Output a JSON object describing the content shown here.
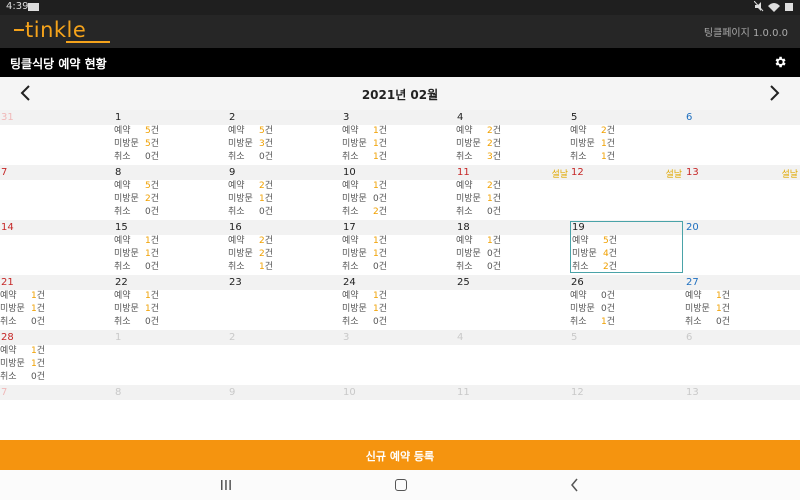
{
  "status": {
    "time": "4:39"
  },
  "app": {
    "logo_text": "tinkle",
    "version": "팅클페이지 1.0.0.0"
  },
  "title": "팅클식당  예약 현황",
  "month_label": "2021년 02월",
  "stat_labels": [
    "예약",
    "미방문",
    "취소"
  ],
  "unit": "건",
  "weeks": [
    [
      {
        "day": "31",
        "other": true,
        "sun": true
      },
      {
        "day": "1",
        "stats": [
          "5",
          "5",
          "0"
        ]
      },
      {
        "day": "2",
        "stats": [
          "5",
          "3",
          "0"
        ]
      },
      {
        "day": "3",
        "stats": [
          "1",
          "1",
          "1"
        ]
      },
      {
        "day": "4",
        "stats": [
          "2",
          "2",
          "3"
        ]
      },
      {
        "day": "5",
        "stats": [
          "2",
          "1",
          "1"
        ]
      },
      {
        "day": "6",
        "sat": true
      }
    ],
    [
      {
        "day": "7",
        "sun": true
      },
      {
        "day": "8",
        "stats": [
          "5",
          "2",
          "0"
        ]
      },
      {
        "day": "9",
        "stats": [
          "2",
          "1",
          "0"
        ]
      },
      {
        "day": "10",
        "stats": [
          "1",
          "0",
          "2"
        ]
      },
      {
        "day": "11",
        "holiday": "설날",
        "sun": true,
        "stats": [
          "2",
          "1",
          "0"
        ]
      },
      {
        "day": "12",
        "holiday": "설날",
        "sun": true
      },
      {
        "day": "13",
        "holiday": "설날",
        "sun": true
      }
    ],
    [
      {
        "day": "14",
        "sun": true
      },
      {
        "day": "15",
        "stats": [
          "1",
          "1",
          "0"
        ]
      },
      {
        "day": "16",
        "stats": [
          "2",
          "2",
          "1"
        ]
      },
      {
        "day": "17",
        "stats": [
          "1",
          "1",
          "0"
        ]
      },
      {
        "day": "18",
        "stats": [
          "1",
          "0",
          "0"
        ]
      },
      {
        "day": "19",
        "stats": [
          "5",
          "4",
          "2"
        ],
        "selected": true
      },
      {
        "day": "20",
        "sat": true
      }
    ],
    [
      {
        "day": "21",
        "sun": true,
        "stats": [
          "1",
          "1",
          "0"
        ]
      },
      {
        "day": "22",
        "stats": [
          "1",
          "1",
          "0"
        ]
      },
      {
        "day": "23"
      },
      {
        "day": "24",
        "stats": [
          "1",
          "1",
          "0"
        ]
      },
      {
        "day": "25"
      },
      {
        "day": "26",
        "stats": [
          "0",
          "0",
          "1"
        ]
      },
      {
        "day": "27",
        "sat": true,
        "stats": [
          "1",
          "1",
          "0"
        ]
      }
    ],
    [
      {
        "day": "28",
        "sun": true,
        "stats": [
          "1",
          "1",
          "0"
        ]
      },
      {
        "day": "1",
        "other": true
      },
      {
        "day": "2",
        "other": true
      },
      {
        "day": "3",
        "other": true
      },
      {
        "day": "4",
        "other": true
      },
      {
        "day": "5",
        "other": true
      },
      {
        "day": "6",
        "other": true
      }
    ],
    [
      {
        "day": "7",
        "other": true,
        "sun": true
      },
      {
        "day": "8",
        "other": true
      },
      {
        "day": "9",
        "other": true
      },
      {
        "day": "10",
        "other": true
      },
      {
        "day": "11",
        "other": true
      },
      {
        "day": "12",
        "other": true
      },
      {
        "day": "13",
        "other": true
      }
    ]
  ],
  "new_reservation_label": "신규 예약 등록",
  "colors": {
    "accent": "#f5940f",
    "logo": "#f5a31b",
    "selected_border": "#4aa3a8",
    "sunday": "#c62828",
    "saturday": "#1e6fbf",
    "holiday": "#e0a800"
  }
}
